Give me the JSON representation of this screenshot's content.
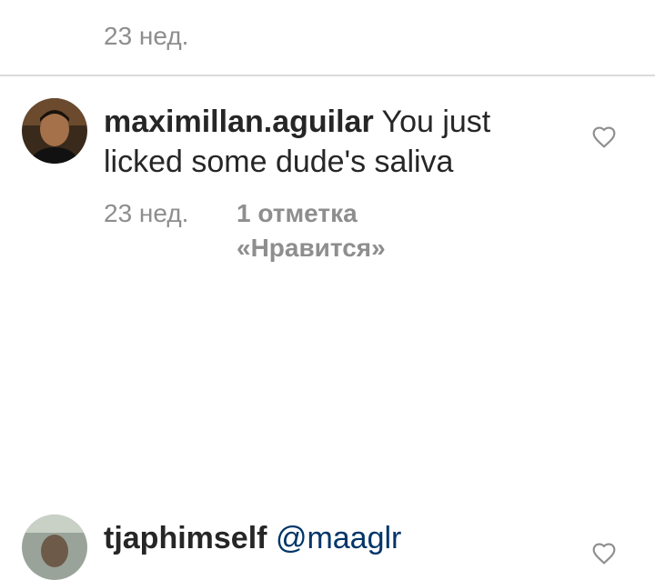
{
  "previous_comment": {
    "time": "23 нед."
  },
  "comments": [
    {
      "username": "maximillan.aguilar",
      "text": "You just licked some dude's saliva",
      "time": "23 нед.",
      "likes": "1 отметка «Нравится»",
      "avatar_icon": "avatar-photo",
      "like_icon": "heart-outline-icon"
    },
    {
      "username": "tjaphimself",
      "mention": "@maaglr",
      "avatar_icon": "avatar-photo",
      "like_icon": "heart-outline-icon"
    }
  ],
  "colors": {
    "text": "#262626",
    "secondary": "#8e8e8e",
    "divider": "#dbdbdb",
    "mention": "#003569"
  }
}
